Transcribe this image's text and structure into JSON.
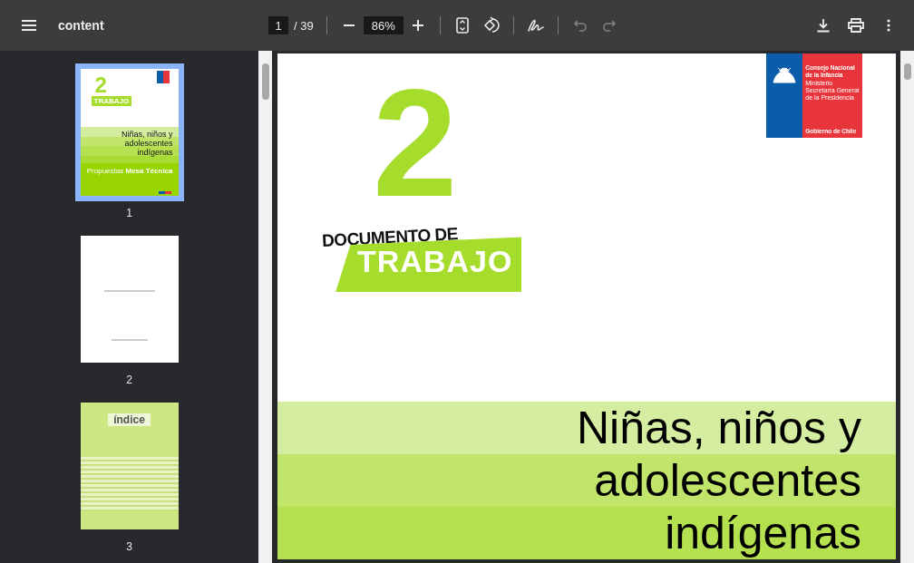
{
  "toolbar": {
    "title": "content",
    "page_input": "1",
    "page_total": "/ 39",
    "zoom": "86%",
    "undo": {
      "disabled": true
    },
    "redo": {
      "disabled": true
    }
  },
  "sidebar": {
    "thumbnails": [
      {
        "page_label": "1",
        "selected": true,
        "kind": "cover",
        "number": "2",
        "tag": "TRABAJO",
        "title": "Niñas, niños y adolescentes indígenas",
        "subtitle": "Propuestas **Mesa Técnica**"
      },
      {
        "page_label": "2",
        "selected": false,
        "kind": "blank"
      },
      {
        "page_label": "3",
        "selected": false,
        "kind": "index",
        "heading": "índice"
      }
    ]
  },
  "document": {
    "number": "2",
    "label_top": "DOCUMENTO DE",
    "label_bottom": "TRABAJO",
    "logo": {
      "name": "Consejo Nacional de la Infancia",
      "ministry": "Ministerio Secretaría General de la Presidencia",
      "government": "Gobierno de Chile"
    },
    "title_lines": [
      "Niñas, niños y",
      "adolescentes",
      "indígenas"
    ]
  }
}
